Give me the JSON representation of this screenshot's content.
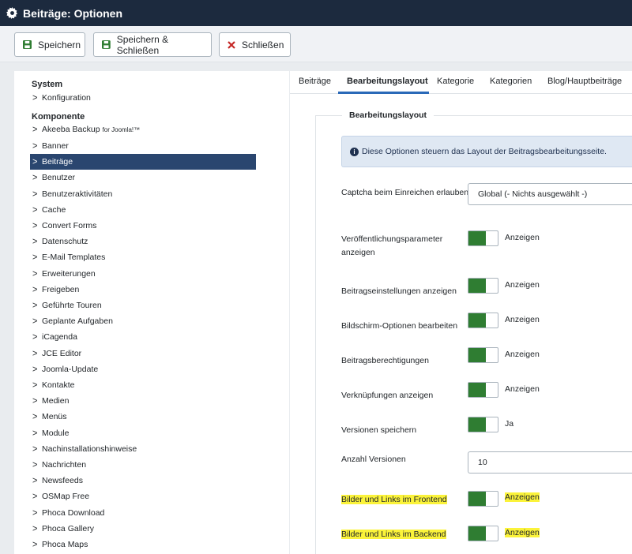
{
  "window": {
    "title": "Beiträge: Optionen",
    "icon": "gear-icon"
  },
  "toolbar": {
    "save_label": "Speichern",
    "save_close_label": "Speichern & Schließen",
    "close_label": "Schließen"
  },
  "sidebar": {
    "system_heading": "System",
    "system_items": [
      "Konfiguration"
    ],
    "components_heading": "Komponente",
    "akeeba_main": "Akeeba Backup",
    "akeeba_suffix": "for Joomla!™",
    "items": [
      "Banner",
      "Beiträge",
      "Benutzer",
      "Benutzeraktivitäten",
      "Cache",
      "Convert Forms",
      "Datenschutz",
      "E-Mail Templates",
      "Erweiterungen",
      "Freigeben",
      "Geführte Touren",
      "Geplante Aufgaben",
      "iCagenda",
      "JCE Editor",
      "Joomla-Update",
      "Kontakte",
      "Medien",
      "Menüs",
      "Module",
      "Nachinstallationshinweise",
      "Nachrichten",
      "Newsfeeds",
      "OSMap Free",
      "Phoca Download",
      "Phoca Gallery",
      "Phoca Maps"
    ],
    "active_item": "Beiträge"
  },
  "tabs": [
    "Beiträge",
    "Bearbeitungslayout",
    "Kategorie",
    "Kategorien",
    "Blog/Hauptbeiträge"
  ],
  "active_tab": "Bearbeitungslayout",
  "form": {
    "legend": "Bearbeitungslayout",
    "info_text": "Diese Optionen steuern das Layout der Beitragsbearbeitungsseite.",
    "captcha_label": "Captcha beim Einreichen erlauben",
    "captcha_value": "Global (- Nichts ausgewählt -)",
    "rows": [
      {
        "label": "Veröffentlichungsparameter anzeigen",
        "value": "Anzeigen"
      },
      {
        "label": "Beitragseinstellungen anzeigen",
        "value": "Anzeigen"
      },
      {
        "label": "Bildschirm-Optionen bearbeiten",
        "value": "Anzeigen"
      },
      {
        "label": "Beitragsberechtigungen",
        "value": "Anzeigen"
      },
      {
        "label": "Verknüpfungen anzeigen",
        "value": "Anzeigen"
      },
      {
        "label": "Versionen speichern",
        "value": "Ja"
      }
    ],
    "versions_label": "Anzahl Versionen",
    "versions_value": "10",
    "frontend_label": "Bilder und Links im Frontend",
    "frontend_value": "Anzeigen",
    "backend_label": "Bilder und Links im Backend",
    "backend_value": "Anzeigen"
  },
  "colors": {
    "titlebar": "#1c2a3e",
    "active_sidebar": "#2a466f",
    "toggle_on": "#2f7d32",
    "highlight": "#fbf33a",
    "tab_underline": "#2a69b8"
  }
}
